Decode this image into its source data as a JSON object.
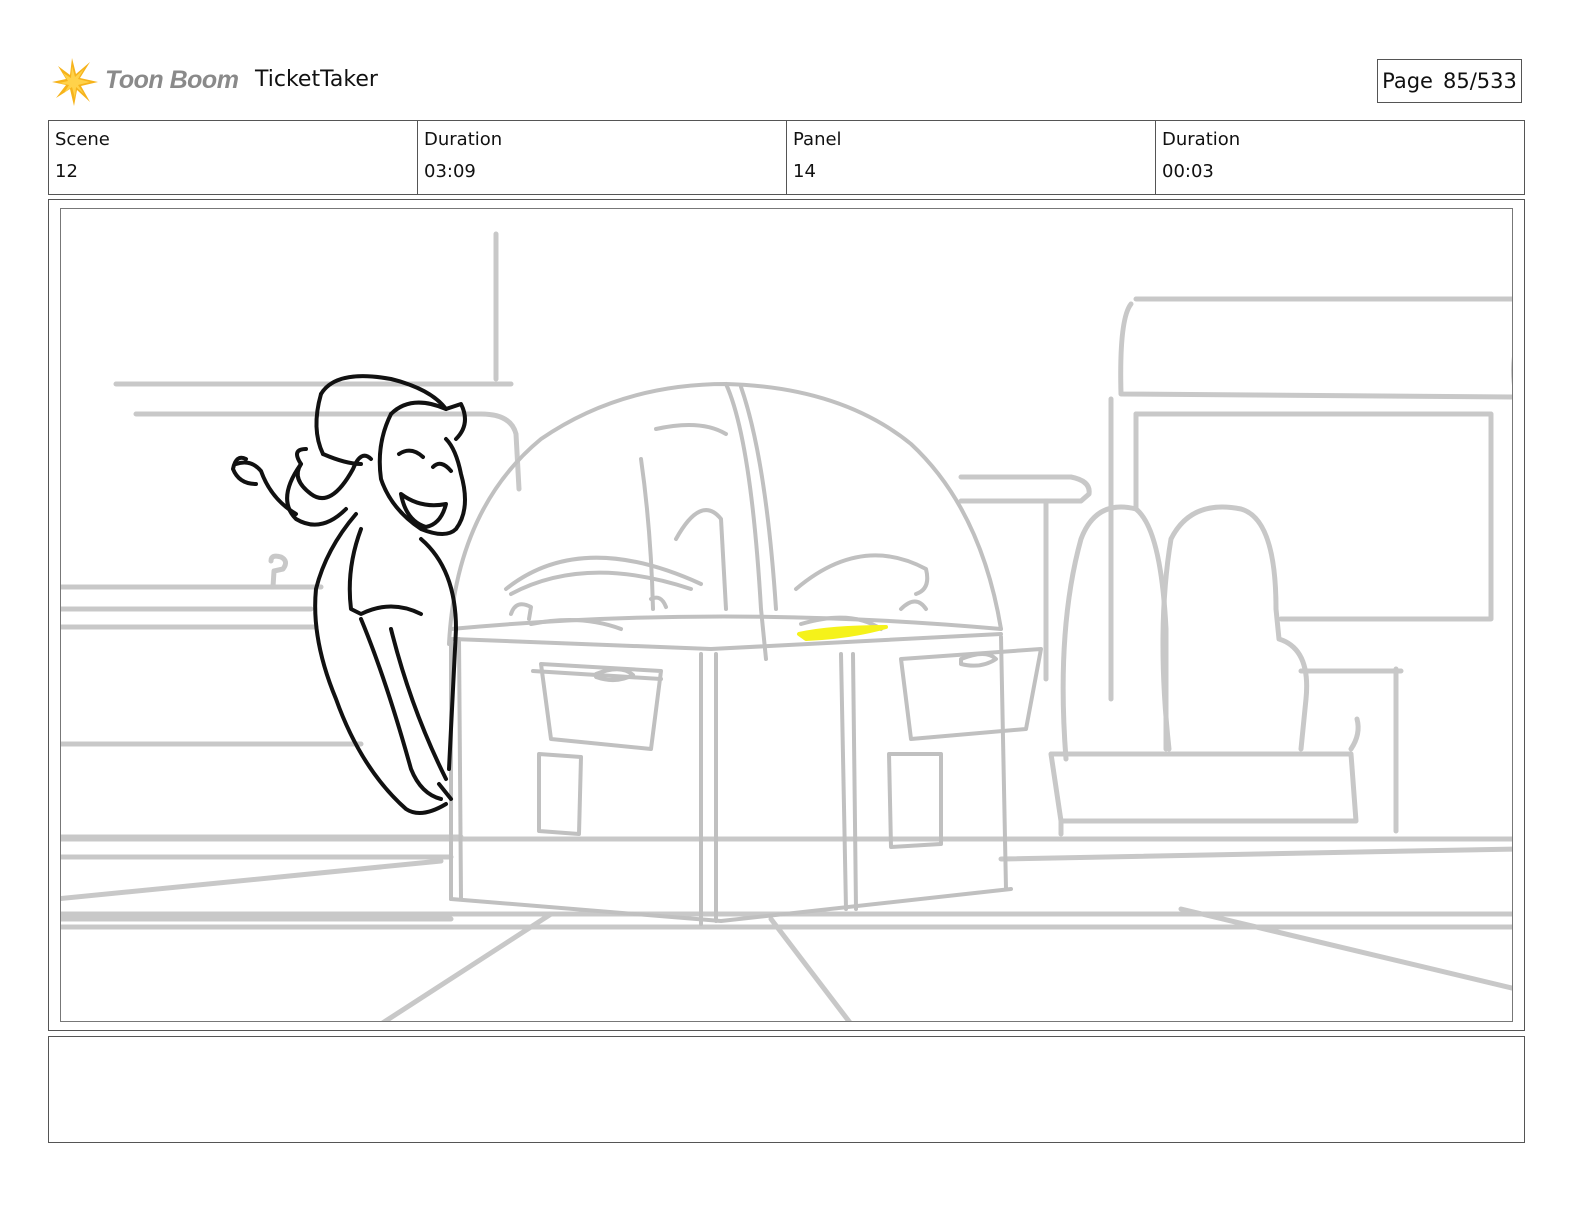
{
  "header": {
    "logo_text": "Toon Boom",
    "project_title": "TicketTaker",
    "page_label": "Page",
    "page_number": "85/533"
  },
  "info": [
    {
      "label": "Scene",
      "value": "12"
    },
    {
      "label": "Duration",
      "value": "03:09"
    },
    {
      "label": "Panel",
      "value": "14"
    },
    {
      "label": "Duration",
      "value": "00:03"
    }
  ],
  "panel": {
    "image": "storyboard-sketch-character-peeking-behind-arcade-machine",
    "highlight_color": "#f5f21a",
    "background_line_color": "#c8c8c8",
    "character_line_color": "#111111"
  },
  "notes": {
    "text": ""
  }
}
